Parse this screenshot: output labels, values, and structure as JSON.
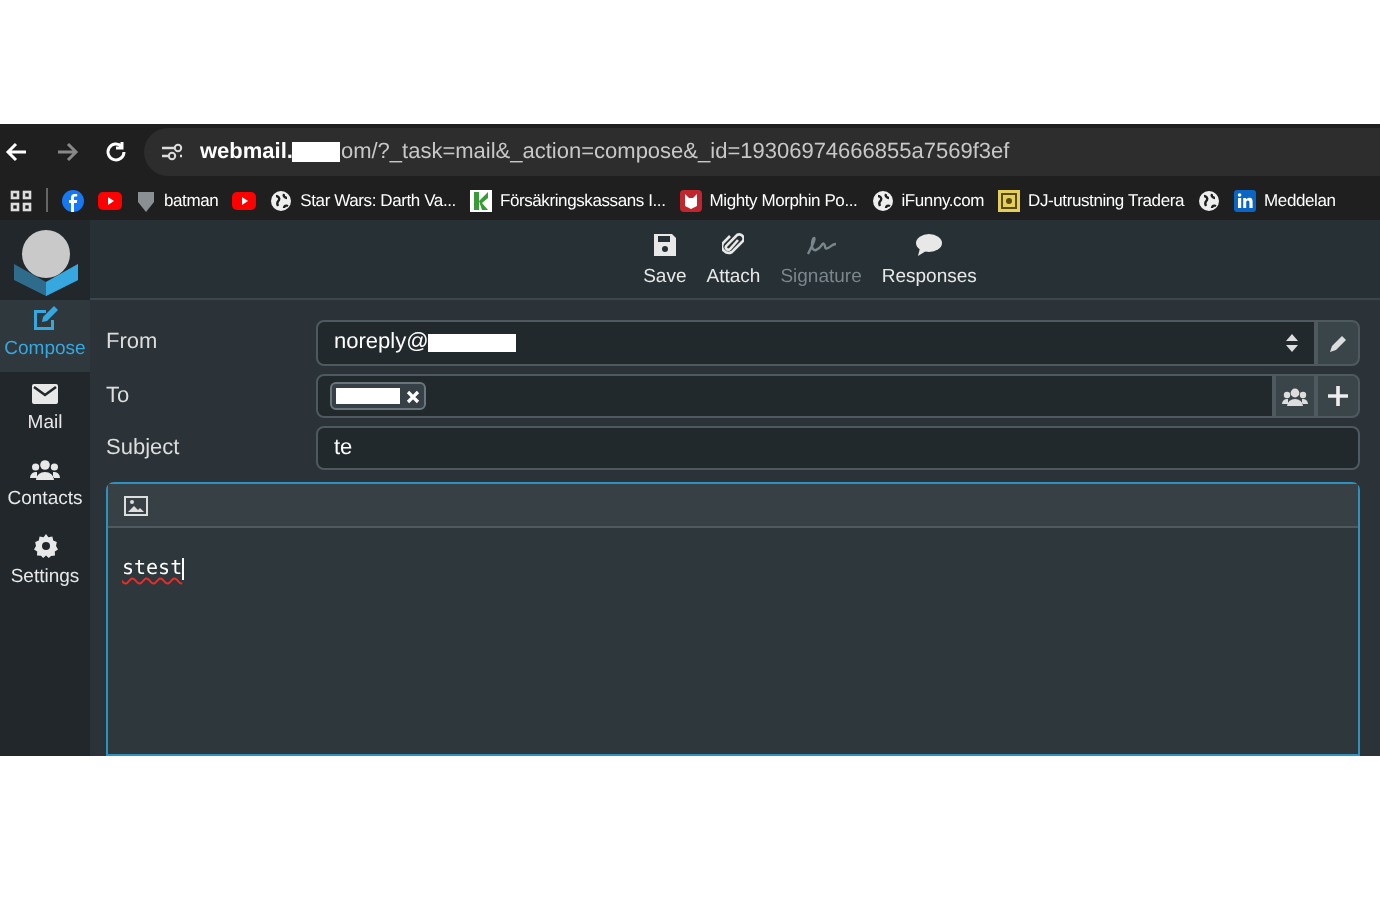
{
  "browser": {
    "url_start": "webmail.",
    "url_end": "om/?_task=mail&_action=compose&_id=19306974666855a7569f3ef",
    "bookmarks": [
      {
        "kind": "apps"
      },
      {
        "kind": "facebook"
      },
      {
        "kind": "youtube"
      },
      {
        "kind": "shield",
        "label": "batman"
      },
      {
        "kind": "youtube"
      },
      {
        "kind": "globe",
        "label": "Star Wars: Darth Va..."
      },
      {
        "kind": "k",
        "label": "Försäkringskassans I..."
      },
      {
        "kind": "cat",
        "label": "Mighty Morphin Po..."
      },
      {
        "kind": "globe",
        "label": "iFunny.com"
      },
      {
        "kind": "yellow",
        "label": "DJ-utrustning Tradera"
      },
      {
        "kind": "globe"
      },
      {
        "kind": "linkedin",
        "label": "Meddelan"
      }
    ]
  },
  "sidebar": {
    "items": [
      {
        "kind": "compose",
        "label": "Compose",
        "selected": true
      },
      {
        "kind": "mail",
        "label": "Mail",
        "selected": false
      },
      {
        "kind": "contacts",
        "label": "Contacts",
        "selected": false
      },
      {
        "kind": "settings",
        "label": "Settings",
        "selected": false
      }
    ]
  },
  "toolbar": [
    {
      "kind": "save",
      "label": "Save",
      "disabled": false
    },
    {
      "kind": "attach",
      "label": "Attach",
      "disabled": false
    },
    {
      "kind": "signature",
      "label": "Signature",
      "disabled": true
    },
    {
      "kind": "responses",
      "label": "Responses",
      "disabled": false
    }
  ],
  "form": {
    "from_label": "From",
    "from_value": "noreply@",
    "to_label": "To",
    "subject_label": "Subject",
    "subject_value": "te"
  },
  "editor": {
    "body": "stest"
  }
}
